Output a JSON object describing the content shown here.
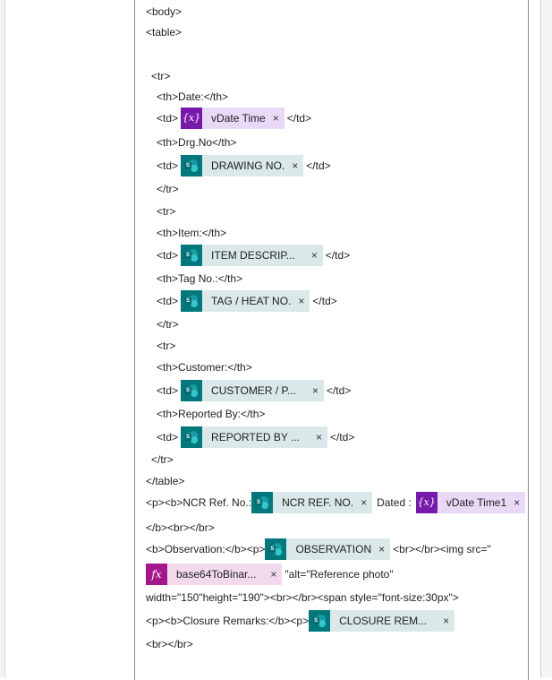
{
  "editor": {
    "lines": {
      "body": "<body>",
      "table": "<table>",
      "tr1": "<tr>",
      "th_date": "<th>Date:</th>",
      "td_open": "<td>",
      "td_close": "</td>",
      "th_drg": "<th>Drg.No</th>",
      "tr_close1": "</tr>",
      "tr2": "<tr>",
      "th_item": "<th>Item:</th>",
      "th_tag": "<th>Tag No.:</th>",
      "tr_close2": "</tr>",
      "tr3": "<tr>",
      "th_customer": "<th>Customer:</th>",
      "th_reported": "<th>Reported By:</th>",
      "tr_close3": "</tr>",
      "table_close": "</table>",
      "ncr_prefix": "<p><b>NCR Ref. No.:",
      "dated": "Dated :",
      "b_br_close": "</b><br></br>",
      "obs_prefix": "<b>Observation:</b><p>",
      "obs_suffix": "<br></br><img src=\"",
      "alt_text": "\"alt=\"Reference photo\"",
      "width_line": "width=\"150\"height=\"190\"><br></br><span style=\"font-size:30px\">",
      "closure_prefix": "<p><b>Closure Remarks:</b><p>",
      "br_close": "<br></br>"
    },
    "tokens": {
      "date": {
        "label": "vDate Time",
        "type": "variable",
        "icon": "{x}"
      },
      "drawing": {
        "label": "DRAWING NO.",
        "type": "sharepoint"
      },
      "item": {
        "label": "ITEM DESCRIP...",
        "type": "sharepoint"
      },
      "tag": {
        "label": "TAG / HEAT NO.",
        "type": "sharepoint"
      },
      "customer": {
        "label": "CUSTOMER / P...",
        "type": "sharepoint"
      },
      "reported": {
        "label": "REPORTED BY ...",
        "type": "sharepoint"
      },
      "ncr": {
        "label": "NCR REF. NO.",
        "type": "sharepoint"
      },
      "date1": {
        "label": "vDate Time1",
        "type": "variable",
        "icon": "{x}"
      },
      "observation": {
        "label": "OBSERVATION",
        "type": "sharepoint"
      },
      "base64": {
        "label": "base64ToBinar...",
        "type": "expression",
        "icon": "fx"
      },
      "closure": {
        "label": "CLOSURE REM...",
        "type": "sharepoint"
      }
    },
    "remove_glyph": "×",
    "sp_letter": "S"
  },
  "colors": {
    "sharepoint_icon": "#03787c",
    "sharepoint_bg": "#dae8ea",
    "variable_icon": "#7719aa",
    "variable_bg": "#ead9f6",
    "expression_icon": "#a5168a",
    "expression_bg": "#f3d9ee"
  }
}
